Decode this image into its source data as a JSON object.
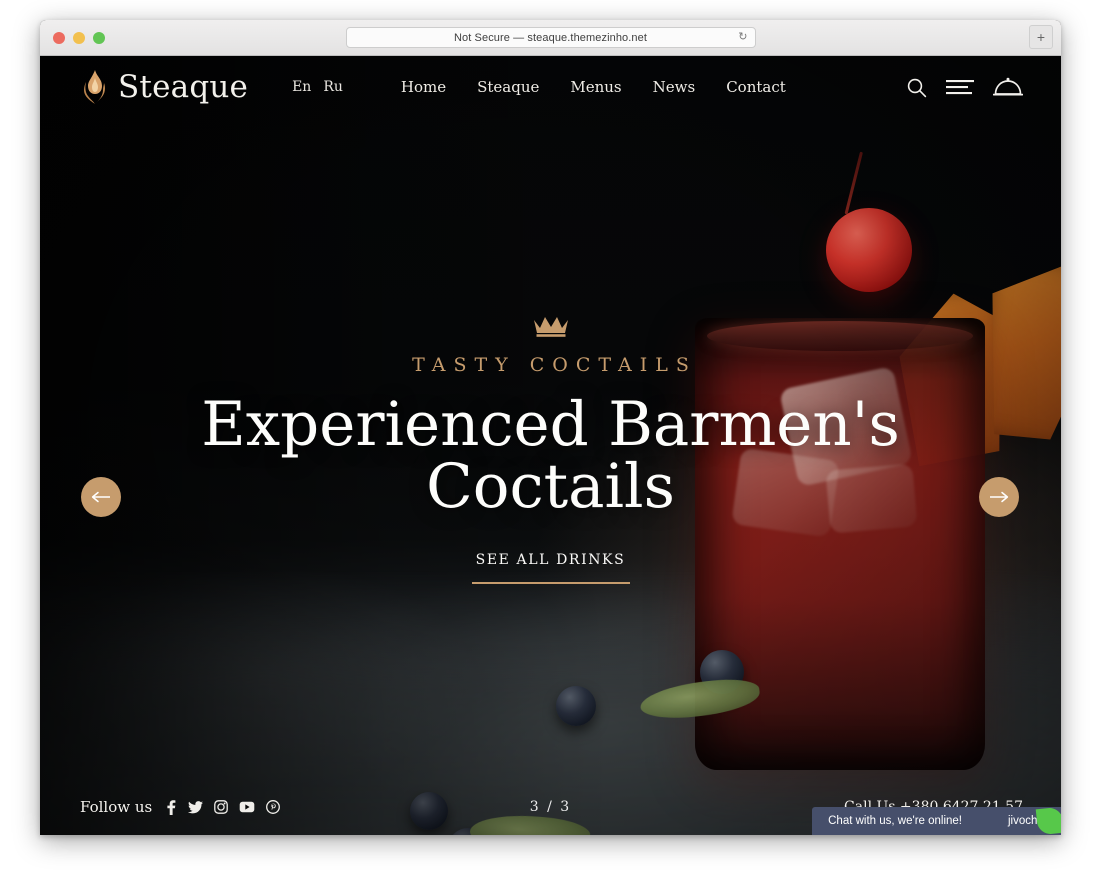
{
  "browser": {
    "url_text": "Not Secure — steaque.themezinho.net",
    "reload_glyph": "↻",
    "new_tab_label": "+",
    "traffic_lights": [
      "close",
      "minimize",
      "maximize"
    ]
  },
  "site_header": {
    "logo_text": "Steaque",
    "logo_icon": "flame-icon",
    "languages": [
      {
        "label": "En"
      },
      {
        "label": "Ru"
      }
    ],
    "nav": [
      {
        "label": "Home"
      },
      {
        "label": "Steaque"
      },
      {
        "label": "Menus"
      },
      {
        "label": "News"
      },
      {
        "label": "Contact"
      }
    ],
    "icons": [
      {
        "name": "search-icon"
      },
      {
        "name": "hamburger-menu-icon"
      },
      {
        "name": "cloche-icon"
      }
    ]
  },
  "hero": {
    "crown_icon": "crown-icon",
    "eyebrow": "TASTY COCTAILS",
    "headline": "Experienced Barmen's Coctails",
    "cta_label": "SEE ALL DRINKS",
    "prev_arrow": "←",
    "next_arrow": "→"
  },
  "footer": {
    "follow_label": "Follow us",
    "social": [
      {
        "name": "facebook-icon"
      },
      {
        "name": "twitter-icon"
      },
      {
        "name": "instagram-icon"
      },
      {
        "name": "youtube-icon"
      },
      {
        "name": "pinterest-icon"
      }
    ],
    "slide_counter": "3 / 3",
    "call_us": "Call Us +380 6427 21 57"
  },
  "chat_widget": {
    "message": "Chat with us, we're online!",
    "brand": "jivochat"
  },
  "colors": {
    "accent_gold": "#c69c6d",
    "hero_text": "#fdfdfb",
    "page_background": "#050505",
    "chat_background": "#464f6b",
    "chat_leaf": "#57c84a"
  }
}
